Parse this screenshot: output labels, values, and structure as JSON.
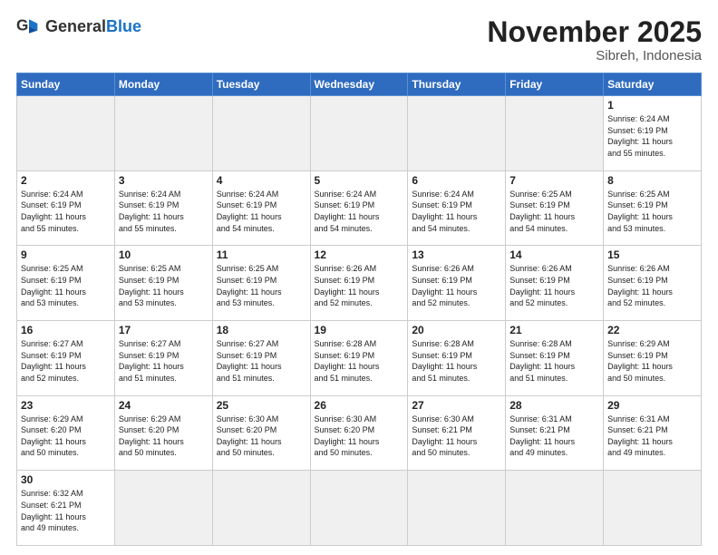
{
  "header": {
    "logo_general": "General",
    "logo_blue": "Blue",
    "title": "November 2025",
    "location": "Sibreh, Indonesia"
  },
  "weekdays": [
    "Sunday",
    "Monday",
    "Tuesday",
    "Wednesday",
    "Thursday",
    "Friday",
    "Saturday"
  ],
  "weeks": [
    [
      {
        "day": "",
        "info": ""
      },
      {
        "day": "",
        "info": ""
      },
      {
        "day": "",
        "info": ""
      },
      {
        "day": "",
        "info": ""
      },
      {
        "day": "",
        "info": ""
      },
      {
        "day": "",
        "info": ""
      },
      {
        "day": "1",
        "info": "Sunrise: 6:24 AM\nSunset: 6:19 PM\nDaylight: 11 hours\nand 55 minutes."
      }
    ],
    [
      {
        "day": "2",
        "info": "Sunrise: 6:24 AM\nSunset: 6:19 PM\nDaylight: 11 hours\nand 55 minutes."
      },
      {
        "day": "3",
        "info": "Sunrise: 6:24 AM\nSunset: 6:19 PM\nDaylight: 11 hours\nand 55 minutes."
      },
      {
        "day": "4",
        "info": "Sunrise: 6:24 AM\nSunset: 6:19 PM\nDaylight: 11 hours\nand 54 minutes."
      },
      {
        "day": "5",
        "info": "Sunrise: 6:24 AM\nSunset: 6:19 PM\nDaylight: 11 hours\nand 54 minutes."
      },
      {
        "day": "6",
        "info": "Sunrise: 6:24 AM\nSunset: 6:19 PM\nDaylight: 11 hours\nand 54 minutes."
      },
      {
        "day": "7",
        "info": "Sunrise: 6:25 AM\nSunset: 6:19 PM\nDaylight: 11 hours\nand 54 minutes."
      },
      {
        "day": "8",
        "info": "Sunrise: 6:25 AM\nSunset: 6:19 PM\nDaylight: 11 hours\nand 53 minutes."
      }
    ],
    [
      {
        "day": "9",
        "info": "Sunrise: 6:25 AM\nSunset: 6:19 PM\nDaylight: 11 hours\nand 53 minutes."
      },
      {
        "day": "10",
        "info": "Sunrise: 6:25 AM\nSunset: 6:19 PM\nDaylight: 11 hours\nand 53 minutes."
      },
      {
        "day": "11",
        "info": "Sunrise: 6:25 AM\nSunset: 6:19 PM\nDaylight: 11 hours\nand 53 minutes."
      },
      {
        "day": "12",
        "info": "Sunrise: 6:26 AM\nSunset: 6:19 PM\nDaylight: 11 hours\nand 52 minutes."
      },
      {
        "day": "13",
        "info": "Sunrise: 6:26 AM\nSunset: 6:19 PM\nDaylight: 11 hours\nand 52 minutes."
      },
      {
        "day": "14",
        "info": "Sunrise: 6:26 AM\nSunset: 6:19 PM\nDaylight: 11 hours\nand 52 minutes."
      },
      {
        "day": "15",
        "info": "Sunrise: 6:26 AM\nSunset: 6:19 PM\nDaylight: 11 hours\nand 52 minutes."
      }
    ],
    [
      {
        "day": "16",
        "info": "Sunrise: 6:27 AM\nSunset: 6:19 PM\nDaylight: 11 hours\nand 52 minutes."
      },
      {
        "day": "17",
        "info": "Sunrise: 6:27 AM\nSunset: 6:19 PM\nDaylight: 11 hours\nand 51 minutes."
      },
      {
        "day": "18",
        "info": "Sunrise: 6:27 AM\nSunset: 6:19 PM\nDaylight: 11 hours\nand 51 minutes."
      },
      {
        "day": "19",
        "info": "Sunrise: 6:28 AM\nSunset: 6:19 PM\nDaylight: 11 hours\nand 51 minutes."
      },
      {
        "day": "20",
        "info": "Sunrise: 6:28 AM\nSunset: 6:19 PM\nDaylight: 11 hours\nand 51 minutes."
      },
      {
        "day": "21",
        "info": "Sunrise: 6:28 AM\nSunset: 6:19 PM\nDaylight: 11 hours\nand 51 minutes."
      },
      {
        "day": "22",
        "info": "Sunrise: 6:29 AM\nSunset: 6:19 PM\nDaylight: 11 hours\nand 50 minutes."
      }
    ],
    [
      {
        "day": "23",
        "info": "Sunrise: 6:29 AM\nSunset: 6:20 PM\nDaylight: 11 hours\nand 50 minutes."
      },
      {
        "day": "24",
        "info": "Sunrise: 6:29 AM\nSunset: 6:20 PM\nDaylight: 11 hours\nand 50 minutes."
      },
      {
        "day": "25",
        "info": "Sunrise: 6:30 AM\nSunset: 6:20 PM\nDaylight: 11 hours\nand 50 minutes."
      },
      {
        "day": "26",
        "info": "Sunrise: 6:30 AM\nSunset: 6:20 PM\nDaylight: 11 hours\nand 50 minutes."
      },
      {
        "day": "27",
        "info": "Sunrise: 6:30 AM\nSunset: 6:21 PM\nDaylight: 11 hours\nand 50 minutes."
      },
      {
        "day": "28",
        "info": "Sunrise: 6:31 AM\nSunset: 6:21 PM\nDaylight: 11 hours\nand 49 minutes."
      },
      {
        "day": "29",
        "info": "Sunrise: 6:31 AM\nSunset: 6:21 PM\nDaylight: 11 hours\nand 49 minutes."
      }
    ],
    [
      {
        "day": "30",
        "info": "Sunrise: 6:32 AM\nSunset: 6:21 PM\nDaylight: 11 hours\nand 49 minutes."
      },
      {
        "day": "",
        "info": ""
      },
      {
        "day": "",
        "info": ""
      },
      {
        "day": "",
        "info": ""
      },
      {
        "day": "",
        "info": ""
      },
      {
        "day": "",
        "info": ""
      },
      {
        "day": "",
        "info": ""
      }
    ]
  ]
}
